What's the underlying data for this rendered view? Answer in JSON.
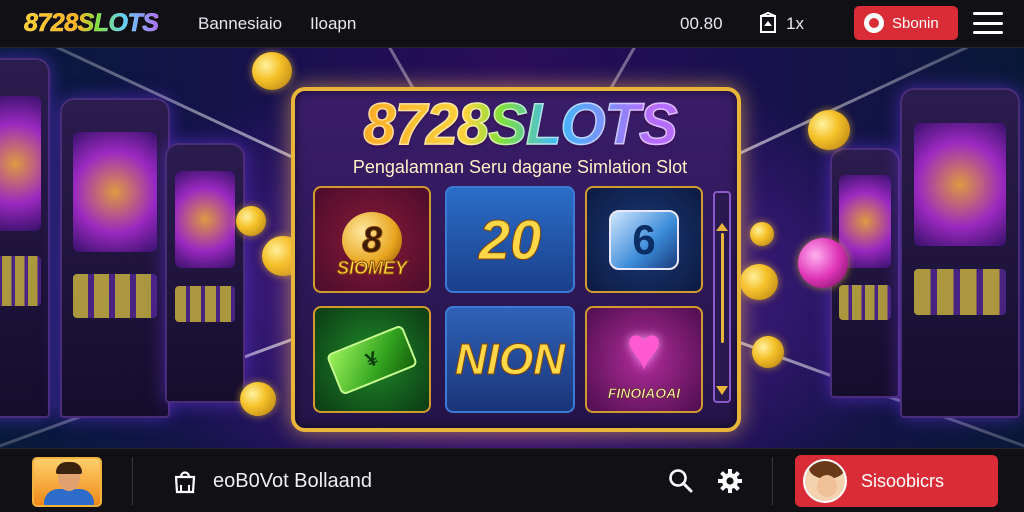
{
  "header": {
    "logo": "8728SLOTS",
    "nav_links": [
      "Bannesiaio",
      "Iloapn"
    ],
    "balance": "00.80",
    "wallet_count": "1x",
    "action_button": "Sbonin",
    "icons": {
      "wallet": "wallet-icon",
      "action": "user-badge-icon",
      "menu": "hamburger-menu-icon"
    }
  },
  "panel": {
    "title": "8728SLOTS",
    "subtitle": "Pengalamnan Seru dagane Simlation Slot",
    "tiles": [
      {
        "name": "money-8",
        "badge": "8",
        "label": "SIOMEY"
      },
      {
        "name": "twenty",
        "label": "20"
      },
      {
        "name": "lucky-7",
        "label": "6"
      },
      {
        "name": "green-bill",
        "label": "¥"
      },
      {
        "name": "nion",
        "label": "NION"
      },
      {
        "name": "heart",
        "label": "FINOIAOAI"
      }
    ]
  },
  "footer": {
    "label": "eoB0Vot Bollaand",
    "button_label": "Sisoobicrs",
    "icons": {
      "bag": "shopping-bag-icon",
      "search": "search-icon",
      "settings": "gear-icon"
    }
  },
  "colors": {
    "accent_red": "#d92c36",
    "gold": "#e8b53a",
    "bar_bg": "#111014"
  }
}
